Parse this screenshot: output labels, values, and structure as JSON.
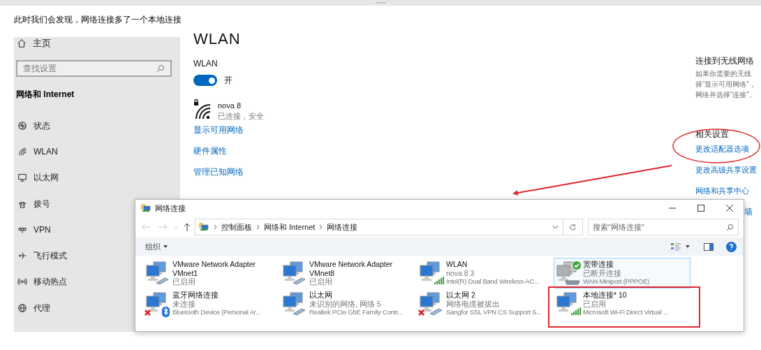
{
  "caption": "此时我们会发现，网络连接多了一个本地连接",
  "settings": {
    "sidebar": {
      "home": "主页",
      "search_placeholder": "查找设置",
      "section": "网络和 Internet",
      "items": [
        "状态",
        "WLAN",
        "以太网",
        "拨号",
        "VPN",
        "飞行模式",
        "移动热点",
        "代理"
      ]
    },
    "page": {
      "title": "WLAN",
      "toggle": {
        "label": "WLAN",
        "on": true,
        "state_text": "开"
      },
      "network": {
        "name": "nova 8",
        "status": "已连接，安全",
        "secured": true
      },
      "links": [
        "显示可用网络",
        "硬件属性",
        "管理已知网络"
      ]
    },
    "aside": {
      "heading": "连接到无线网络",
      "text_lines": [
        "如果你需要的无线",
        "择“显示可用网络”，",
        "网络并选择“连接”。"
      ],
      "related_heading": "相关设置",
      "related_links": [
        "更改适配器选项",
        "更改高级共享设置",
        "网络和共享中心"
      ],
      "partly_hidden_link": "墙"
    }
  },
  "explorer": {
    "title": "网络连接",
    "breadcrumb": [
      "控制面板",
      "网络和 Internet",
      "网络连接"
    ],
    "search_placeholder": "搜索\"网络连接\"",
    "organize": "组织",
    "items": [
      {
        "name": "VMware Network Adapter VMnet1",
        "status": "已启用",
        "kind": "cable",
        "error": false,
        "checked": false,
        "selected": false,
        "highlighted": false
      },
      {
        "name": "VMware Network Adapter VMnet8",
        "status": "已启用",
        "kind": "cable",
        "error": false,
        "checked": false,
        "selected": false,
        "highlighted": false
      },
      {
        "name": "WLAN",
        "status": "nova 8 3",
        "device": "Intel(R) Dual Band Wireless-AC...",
        "kind": "signal",
        "error": false,
        "checked": false,
        "selected": false,
        "highlighted": false
      },
      {
        "name": "宽带连接",
        "status": "已断开连接",
        "device": "WAN Miniport (PPPOE)",
        "kind": "modem",
        "error": false,
        "checked": true,
        "selected": true,
        "highlighted": false
      },
      {
        "name": "蓝牙网络连接",
        "status": "未连接",
        "device": "Bluetooth Device (Personal Ar...",
        "kind": "bluetooth",
        "error": true,
        "checked": false,
        "selected": false,
        "highlighted": false
      },
      {
        "name": "以太网",
        "status": "未识别的网络, 网络 5",
        "device": "Realtek PCIe GbE Family Contr...",
        "kind": "cable",
        "error": false,
        "checked": false,
        "selected": false,
        "highlighted": false
      },
      {
        "name": "以太网 2",
        "status": "网络电缆被拔出",
        "device": "Sangfor SSL VPN CS Support S...",
        "kind": "cable",
        "error": true,
        "checked": false,
        "selected": false,
        "highlighted": false
      },
      {
        "name": "本地连接* 10",
        "status": "已启用",
        "device": "Microsoft Wi-Fi Direct Virtual ...",
        "kind": "signal",
        "error": false,
        "checked": false,
        "selected": false,
        "highlighted": true
      }
    ]
  }
}
